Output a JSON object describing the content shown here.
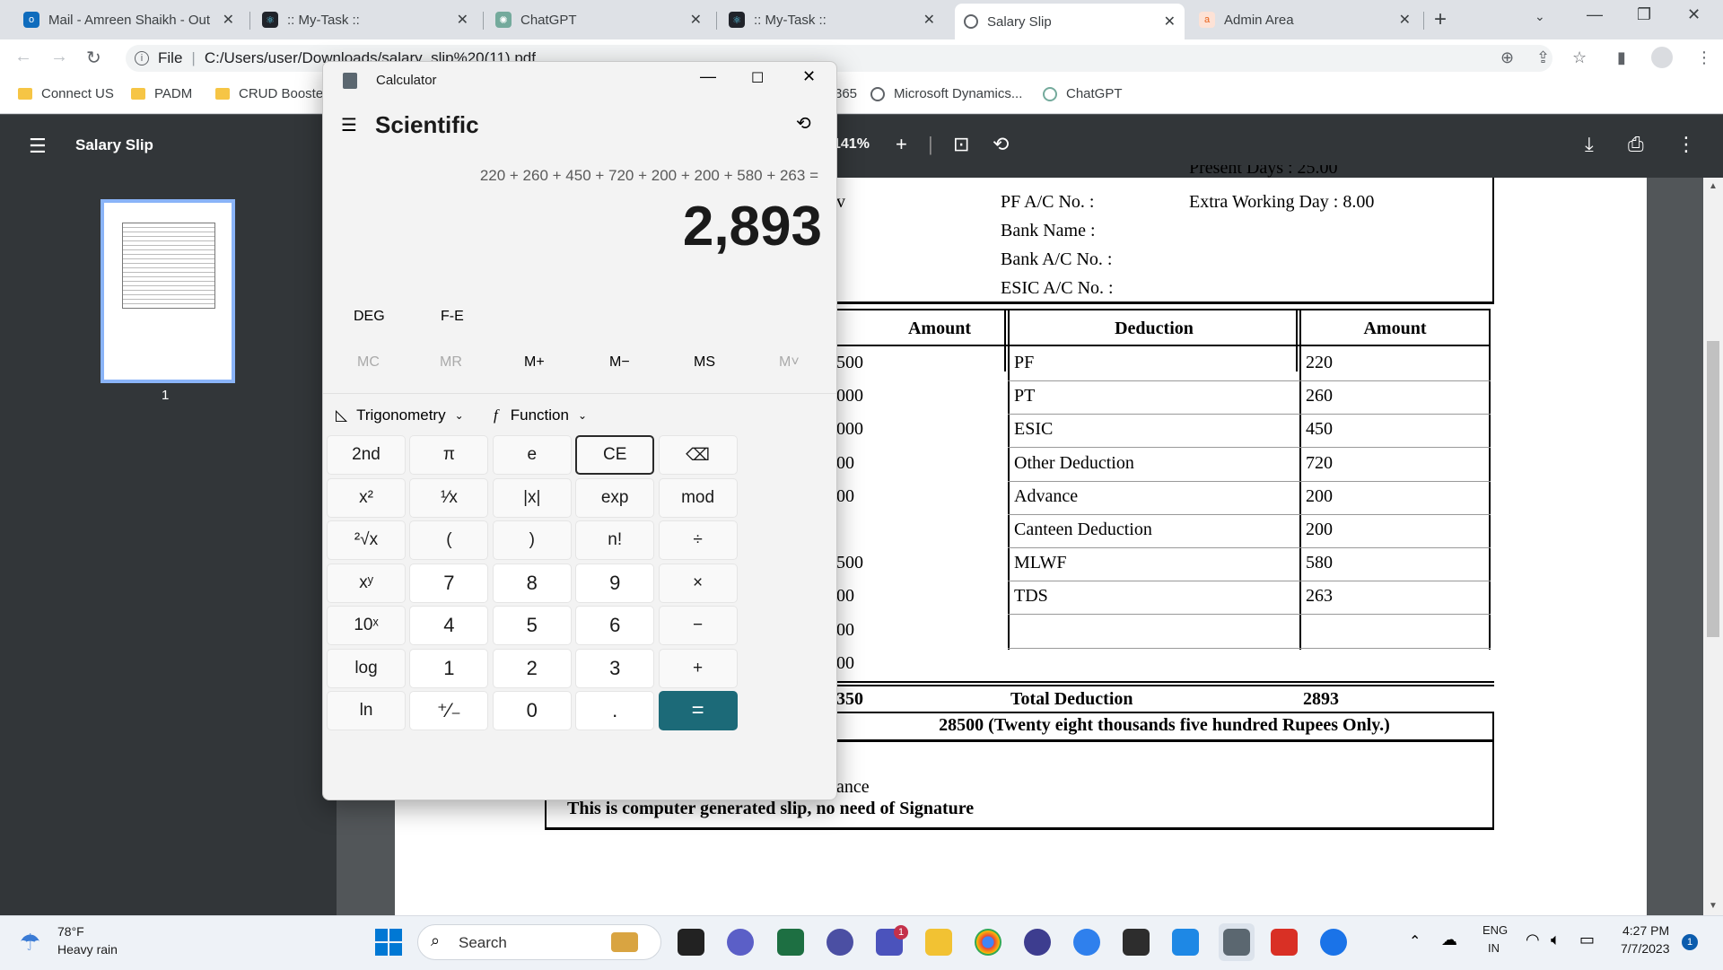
{
  "browser": {
    "tabs": [
      {
        "title": "Mail - Amreen Shaikh - Out",
        "active": false
      },
      {
        "title": ":: My-Task ::",
        "active": false
      },
      {
        "title": "ChatGPT",
        "active": false
      },
      {
        "title": ":: My-Task ::",
        "active": false
      },
      {
        "title": "Salary Slip",
        "active": true
      },
      {
        "title": "Admin Area",
        "active": false
      }
    ],
    "address_label": "File",
    "url": "C:/Users/user/Downloads/salary_slip%20(11).pdf",
    "bookmarks": [
      "Connect US",
      "PADM",
      "CRUD Booster",
      "365",
      "Microsoft Dynamics...",
      "ChatGPT"
    ]
  },
  "pdf": {
    "title": "Salary Slip",
    "zoom": "141%",
    "page_number": "1",
    "info": {
      "row0_right": "Present Days : 25.00",
      "pf": "PF A/C No. :",
      "extra": "Extra Working Day : 8.00",
      "bank_name": "Bank Name :",
      "bank_ac": "Bank A/C No. :",
      "esic_ac": "ESIC A/C No. :",
      "partial_v": "v"
    },
    "headers": {
      "amount1": "Amount",
      "deduction": "Deduction",
      "amount2": "Amount"
    },
    "earn_partial": [
      "500",
      "000",
      "000",
      "00",
      "00",
      "",
      "500",
      "00",
      "00",
      "00"
    ],
    "deductions": [
      {
        "name": "PF",
        "amount": "220"
      },
      {
        "name": "PT",
        "amount": "260"
      },
      {
        "name": "ESIC",
        "amount": "450"
      },
      {
        "name": "Other Deduction",
        "amount": "720"
      },
      {
        "name": "Advance",
        "amount": "200"
      },
      {
        "name": "Canteen Deduction",
        "amount": "200"
      },
      {
        "name": "MLWF",
        "amount": "580"
      },
      {
        "name": "TDS",
        "amount": "263"
      },
      {
        "name": "",
        "amount": ""
      },
      {
        "name": "",
        "amount": ""
      }
    ],
    "total_earn_partial": "350",
    "total_deduction_label": "Total Deduction",
    "total_deduction": "2893",
    "net_words": "28500 (Twenty eight thousands five hundred Rupees Only.)",
    "note_partial": "ance",
    "footer": "This is computer generated slip, no need of Signature"
  },
  "calculator": {
    "app_name": "Calculator",
    "mode": "Scientific",
    "expression": "220 + 260 + 450 + 720 + 200 + 200 + 580 + 263 =",
    "result": "2,893",
    "deg": "DEG",
    "fe": "F-E",
    "memory": [
      "MC",
      "MR",
      "M+",
      "M−",
      "MS",
      "M˅"
    ],
    "trig": "Trigonometry",
    "func": "Function",
    "keys": [
      [
        "2nd",
        "π",
        "e",
        "CE",
        "⌫"
      ],
      [
        "x²",
        "¹⁄x",
        "|x|",
        "exp",
        "mod"
      ],
      [
        "²√x",
        "(",
        ")",
        "n!",
        "÷"
      ],
      [
        "xʸ",
        "7",
        "8",
        "9",
        "×"
      ],
      [
        "10ˣ",
        "4",
        "5",
        "6",
        "−"
      ],
      [
        "log",
        "1",
        "2",
        "3",
        "+"
      ],
      [
        "ln",
        "⁺⁄₋",
        "0",
        ".",
        "="
      ]
    ]
  },
  "taskbar": {
    "weather_temp": "78°F",
    "weather_desc": "Heavy rain",
    "search_placeholder": "Search",
    "lang_top": "ENG",
    "lang_bottom": "IN",
    "time": "4:27 PM",
    "date": "7/7/2023",
    "notifications": "1",
    "teams_badge": "1"
  },
  "colors": {
    "equals": "#1c6a78",
    "accent": "#8ab4f8"
  }
}
